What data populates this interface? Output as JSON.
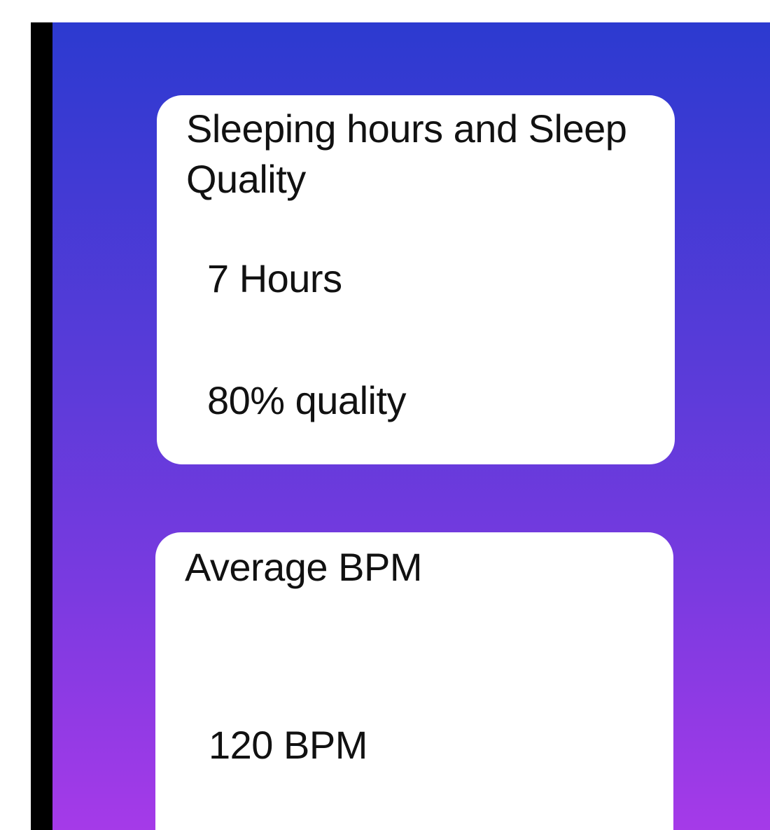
{
  "sleep_card": {
    "title": "Sleeping hours and Sleep Quality",
    "hours": "7 Hours",
    "quality": "80% quality"
  },
  "bpm_card": {
    "title": "Average BPM",
    "value": "120 BPM"
  },
  "colors": {
    "gradient_top": "#2c3ad0",
    "gradient_bottom": "#a53ae8",
    "card_background": "#ffffff",
    "text": "#111111",
    "left_bar": "#000000"
  }
}
